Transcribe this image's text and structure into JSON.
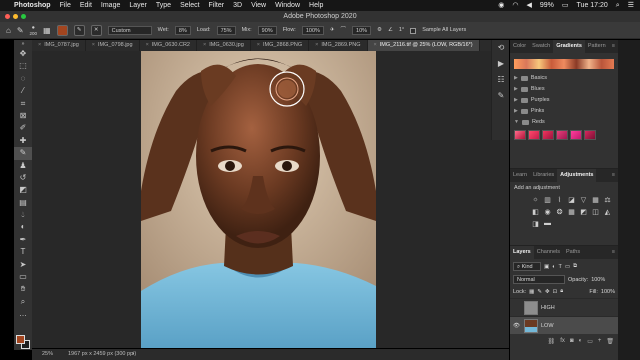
{
  "menubar": {
    "apple": "",
    "app_name": "Photoshop",
    "items": [
      "File",
      "Edit",
      "Image",
      "Layer",
      "Type",
      "Select",
      "Filter",
      "3D",
      "View",
      "Window",
      "Help"
    ],
    "battery": "99%",
    "clock": "Tue 17:20"
  },
  "window": {
    "title": "Adobe Photoshop 2020"
  },
  "options_bar": {
    "brush_size": "200",
    "mode_label": "",
    "mode_value": "Custom",
    "wet_label": "Wet:",
    "wet_value": "8%",
    "load_label": "Load:",
    "load_value": "75%",
    "mix_label": "Mix:",
    "mix_value": "90%",
    "flow_label": "Flow:",
    "flow_value": "100%",
    "smoothing_value": "10%",
    "angle_value": "1°",
    "sample_all_layers": "Sample All Layers"
  },
  "document_tabs": [
    {
      "name": "IMG_0787.jpg",
      "active": false
    },
    {
      "name": "IMG_0798.jpg",
      "active": false
    },
    {
      "name": "IMG_0630.CR2",
      "active": false
    },
    {
      "name": "IMG_0630.jpg",
      "active": false
    },
    {
      "name": "IMG_2868.PNG",
      "active": false
    },
    {
      "name": "IMG_2869.PNG",
      "active": false
    },
    {
      "name": "IMG_2116.tif @ 25% (LOW, RGB/16*)",
      "active": true
    }
  ],
  "status_bar": {
    "zoom": "25%",
    "doc_info": "1967 px x 2459 px (300 ppi)"
  },
  "panels": {
    "gradients_tabs": [
      "Color",
      "Swatch",
      "Gradients",
      "Pattern"
    ],
    "gradients_active": "Gradients",
    "gradient_groups": [
      "Basics",
      "Blues",
      "Purples",
      "Pinks",
      "Reds"
    ],
    "adjust_tabs": [
      "Learn",
      "Libraries",
      "Adjustments"
    ],
    "adjust_active": "Adjustments",
    "add_adjustment": "Add an adjustment",
    "layers_tabs": [
      "Layers",
      "Channels",
      "Paths"
    ],
    "layers_active": "Layers",
    "kind_label": "Kind",
    "blend_mode": "Normal",
    "opacity_label": "Opacity:",
    "opacity_value": "100%",
    "lock_label": "Lock:",
    "fill_label": "Fill:",
    "fill_value": "100%",
    "layers": [
      {
        "name": "HIGH",
        "visible": false,
        "selected": false
      },
      {
        "name": "LOW",
        "visible": true,
        "selected": true
      }
    ]
  },
  "colors": {
    "foreground": "#a2451f",
    "background": "#1e1e1e",
    "photo_shirt": "#74b8d8",
    "photo_skin": "#6b3a22"
  }
}
